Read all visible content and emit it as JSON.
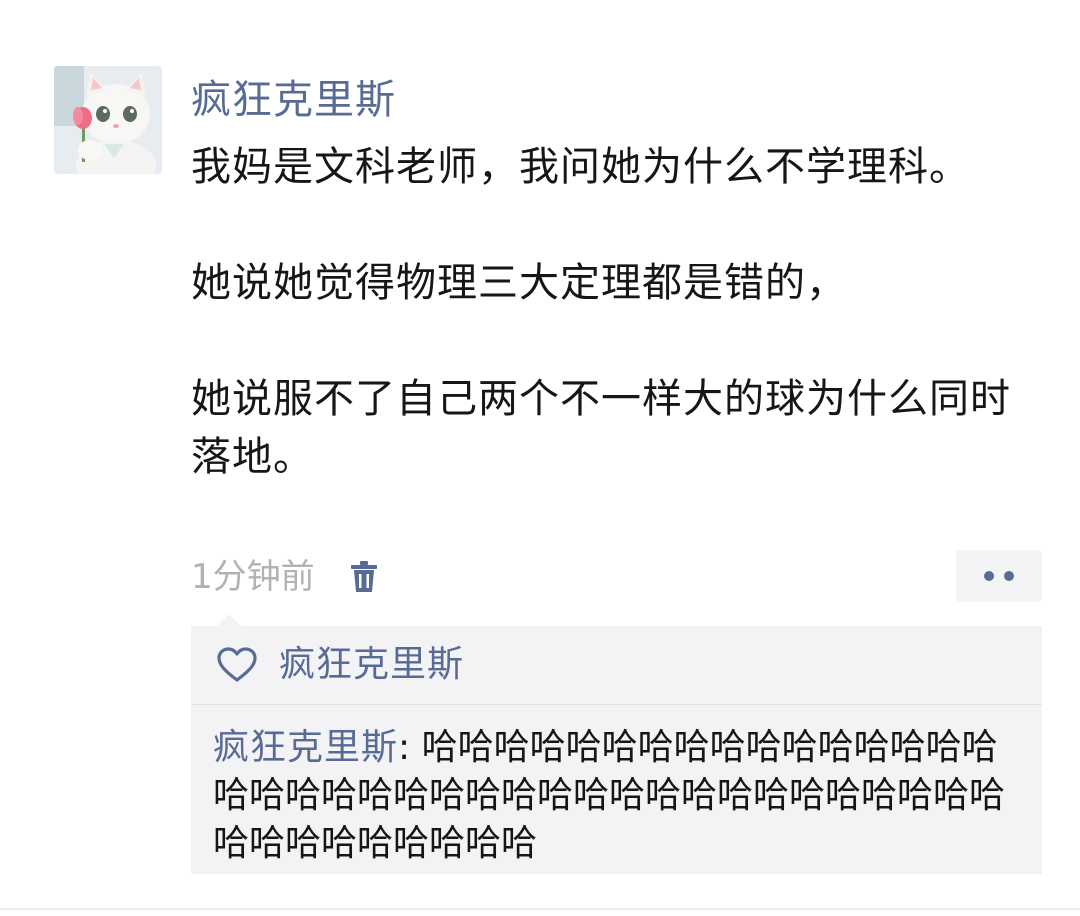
{
  "post": {
    "username": "疯狂克里斯",
    "paragraphs": [
      "我妈是文科老师，我问她为什么不学理科。",
      "她说她觉得物理三大定理都是错的，",
      "她说服不了自己两个不一样大的球为什么同时落地。"
    ],
    "timestamp": "1分钟前",
    "icons": {
      "delete": "trash-icon",
      "more": "more-dots-icon",
      "like": "heart-icon"
    }
  },
  "likes": {
    "names": "疯狂克里斯"
  },
  "comments": [
    {
      "author": "疯狂克里斯",
      "separator": ": ",
      "text": "哈哈哈哈哈哈哈哈哈哈哈哈哈哈哈哈哈哈哈哈哈哈哈哈哈哈哈哈哈哈哈哈哈哈哈哈哈哈哈哈哈哈哈哈哈哈哈"
    }
  ],
  "colors": {
    "link": "#576b95",
    "timestamp": "#b2b2b2",
    "panel": "#f3f3f5",
    "text": "#161616"
  }
}
